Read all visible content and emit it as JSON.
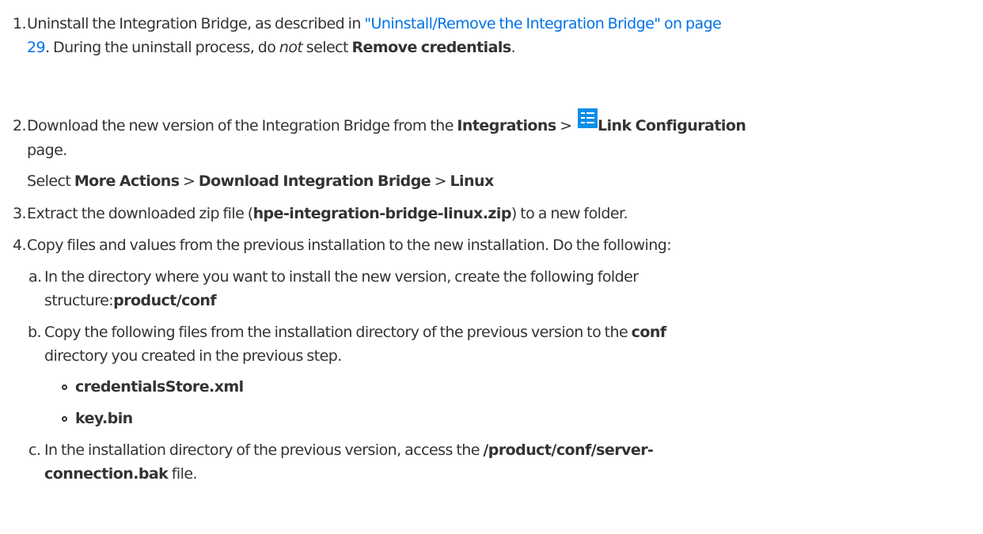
{
  "steps": [
    {
      "num": "1.",
      "line1_pre": "Uninstall the Integration Bridge, as described in ",
      "line1_link": "\"Uninstall/Remove the Integration Bridge\" on page",
      "line2_link": "29",
      "line2_mid": ". During the uninstall process, do ",
      "line2_em": "not",
      "line2_mid2": " select ",
      "line2_bold": "Remove credentials",
      "line2_end": "."
    },
    {
      "num": "2.",
      "line1_pre": "Download the new version of the Integration Bridge from the ",
      "line1_bold1": "Integrations",
      "line1_sep": " > ",
      "icon": "link-configuration-icon",
      "line1_bold2": "Link Configuration",
      "line2": "page.",
      "line3_bold1": "More Actions",
      "line3_pre": "Select ",
      "line3_sep1": " > ",
      "line3_bold2": "Download Integration Bridge",
      "line3_sep2": " > ",
      "line3_bold3": "Linux"
    },
    {
      "num": "3.",
      "pre": "Extract the downloaded zip file (",
      "bold": "hpe-integration-bridge-linux.zip",
      "post": ") to a new folder."
    },
    {
      "num": "4.",
      "text": "Copy files and values from the previous installation to the new installation. Do the following:"
    }
  ],
  "substeps": [
    {
      "letter": "a.",
      "line1": "In the directory where you want to install the new version, create the following folder",
      "line2_pre": "structure:",
      "line2_bold": "product/conf"
    },
    {
      "letter": "b.",
      "line1_pre": "Copy the following files from the installation directory of the previous version to the ",
      "line1_bold": "conf",
      "line2": "directory you created in the previous step.",
      "bullets": [
        "credentialsStore.xml",
        "key.bin"
      ]
    },
    {
      "letter": "c.",
      "line1_pre": "In the installation directory of the previous version, access the ",
      "line1_bold": "/product/conf/server-",
      "line2_bold": "connection.bak",
      "line2_post": " file."
    }
  ],
  "colors": {
    "text": "#333333",
    "link": "#0073e7",
    "icon": "#0a8ee8"
  }
}
